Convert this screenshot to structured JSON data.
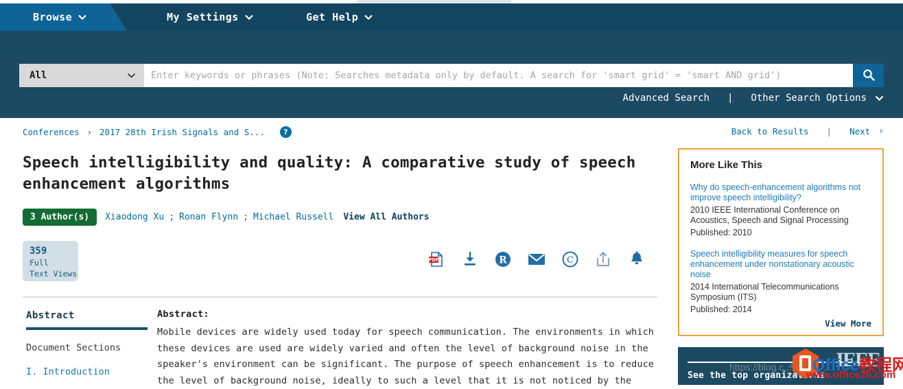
{
  "header": {
    "browse_label": "Browse",
    "my_settings_label": "My Settings",
    "get_help_label": "Get Help",
    "caret_glyph": "⌄"
  },
  "search": {
    "scope_value": "All",
    "placeholder": "Enter keywords or phrases (Note: Searches metadata only by default. A search for 'smart grid' = 'smart AND grid')",
    "input_value": "",
    "advanced_search_label": "Advanced Search",
    "other_search_options_label": "Other Search Options",
    "divider": "|",
    "search_icon": "search-icon"
  },
  "breadcrumb": {
    "items": [
      {
        "label": "Conferences"
      },
      {
        "label": "2017 28th Irish Signals and S..."
      }
    ],
    "separator": "›",
    "help_glyph": "?"
  },
  "result_nav": {
    "back_label": "Back to Results",
    "divider": "|",
    "next_label": "Next",
    "next_caret": "›"
  },
  "document": {
    "title": "Speech intelligibility and quality: A comparative study of speech enhancement algorithms",
    "author_badge": "3 Author(s)",
    "authors": [
      "Xiaodong Xu",
      "Ronan Flynn",
      "Michael Russell"
    ],
    "author_separator": ";",
    "view_all_authors_label": "View All Authors",
    "views_count": "359",
    "views_label_line1": "Full",
    "views_label_line2": "Text Views"
  },
  "actions": [
    {
      "name": "pdf-icon",
      "title": "PDF"
    },
    {
      "name": "download-icon",
      "title": "Download"
    },
    {
      "name": "research-gate-icon",
      "title": "R"
    },
    {
      "name": "email-icon",
      "title": "Email"
    },
    {
      "name": "copyright-icon",
      "title": "Copyright"
    },
    {
      "name": "share-icon",
      "title": "Share"
    },
    {
      "name": "alert-bell-icon",
      "title": "Alerts"
    }
  ],
  "left_nav": {
    "abstract_tab": "Abstract",
    "document_sections_label": "Document Sections",
    "sections": [
      {
        "label": "I.  Introduction"
      }
    ]
  },
  "abstract": {
    "heading": "Abstract:",
    "text": "Mobile devices are widely used today for speech communication. The environments in which these devices are used are widely varied and often the level of background noise in the speaker's environment can be significant. The purpose of speech enhancement is to reduce the level of background noise, ideally to such a level that it is not noticed by the"
  },
  "more_like_this": {
    "title": "More Like This",
    "entries": [
      {
        "title": "Why do speech-enhancement algorithms not improve speech intelligibility?",
        "venue": "2010 IEEE International Conference on Acoustics, Speech and Signal Processing",
        "published": "Published: 2010"
      },
      {
        "title": "Speech intelligibility measures for speech enhancement under nonstationary acoustic noise",
        "venue": "2014 International Telecommunications Symposium (ITS)",
        "published": "Published: 2014"
      }
    ],
    "view_more_label": "View More"
  },
  "promo": {
    "text": "See the top organizations",
    "logo_text": "IEEE"
  },
  "watermarks": {
    "url": "https://blog.c...net/qq_...",
    "brand_blue": "Office",
    "brand_red": "教程网",
    "brand_url": "www.office26.com"
  },
  "colors": {
    "header_dark": "#144560",
    "search_band": "#1d4a63",
    "browse_tab": "#0f6497",
    "link_blue": "#006b9f",
    "author_badge_green": "#136c33",
    "sidebar_border_orange": "#e8a33d",
    "views_box_bg": "#d2dfe6"
  }
}
